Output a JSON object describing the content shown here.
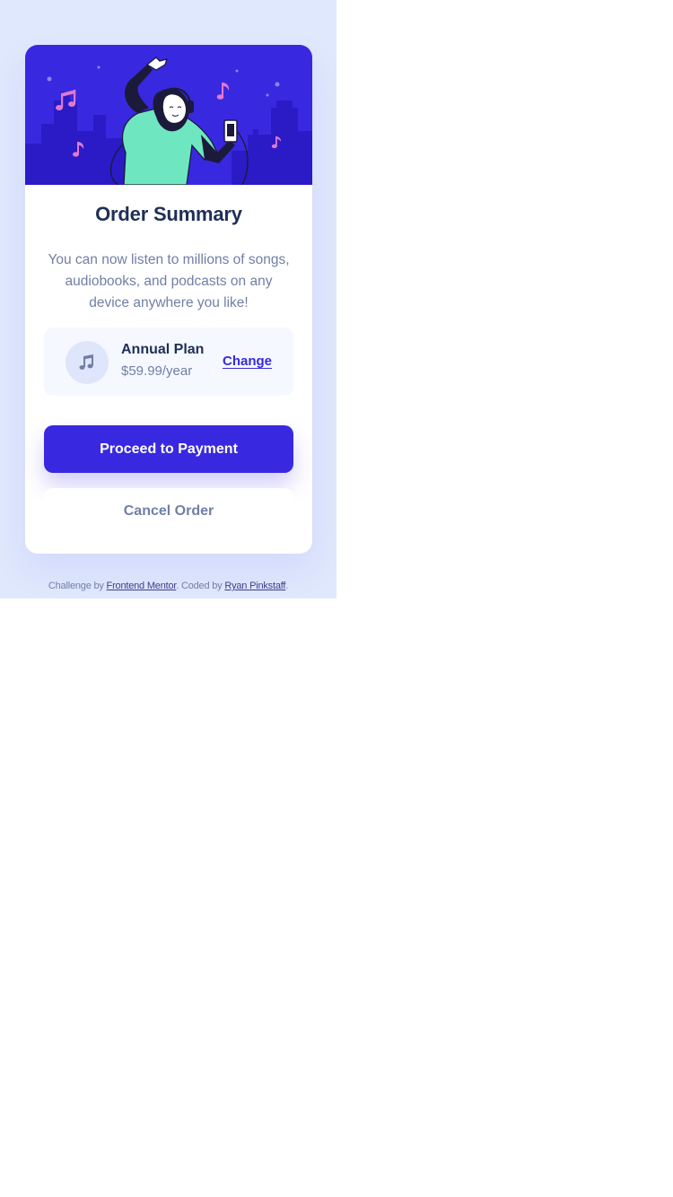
{
  "card": {
    "title": "Order Summary",
    "description": "You can now listen to millions of songs, audiobooks, and podcasts on any device anywhere you like!",
    "plan": {
      "icon": "music-note-icon",
      "name": "Annual Plan",
      "price": "$59.99/year",
      "change_label": "Change"
    },
    "proceed_label": "Proceed to Payment",
    "cancel_label": "Cancel Order"
  },
  "footer": {
    "challenge_prefix": "Challenge by ",
    "challenge_link": "Frontend Mentor",
    "coded_prefix": ". Coded by ",
    "coded_link": "Ryan Pinkstaff",
    "suffix": "."
  },
  "colors": {
    "background": "#e0e8fd",
    "accent": "#3829e0",
    "heading": "#1f2f56",
    "muted": "#717fa6",
    "plan_bg": "#f5f8ff",
    "hero_skyline": "#2a1bc6",
    "figure_shirt": "#6ee7c0",
    "note_pink": "#e079d0"
  }
}
